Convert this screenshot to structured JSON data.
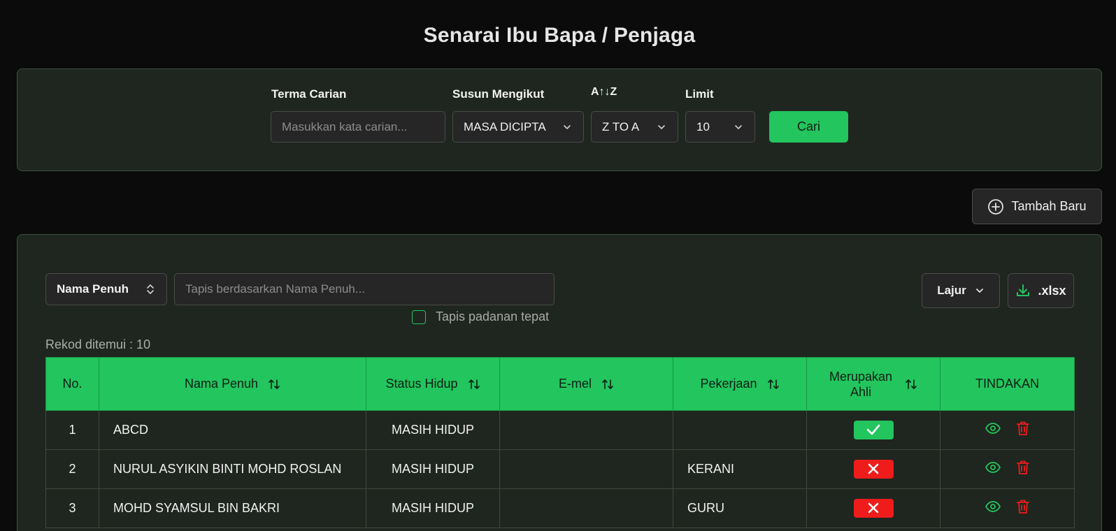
{
  "page": {
    "title": "Senarai Ibu Bapa / Penjaga"
  },
  "search": {
    "term_label": "Terma Carian",
    "term_placeholder": "Masukkan kata carian...",
    "sort_label": "Susun Mengikut",
    "sort_value": "MASA DICIPTA",
    "order_label": "A↑↓Z",
    "order_value": "Z TO A",
    "limit_label": "Limit",
    "limit_value": "10",
    "submit_label": "Cari"
  },
  "add_button": {
    "label": "Tambah Baru"
  },
  "filter": {
    "column_value": "Nama Penuh",
    "placeholder": "Tapis berdasarkan Nama Penuh...",
    "exact_match_label": "Tapis padanan tepat",
    "exact_match_checked": false,
    "columns_button": "Lajur",
    "export_button": ".xlsx"
  },
  "records": {
    "count_text": "Rekod ditemui : 10"
  },
  "table": {
    "headers": {
      "no": "No.",
      "name": "Nama Penuh",
      "status": "Status Hidup",
      "email": "E-mel",
      "job": "Pekerjaan",
      "member_line1": "Merupakan",
      "member_line2": "Ahli",
      "actions": "TINDAKAN"
    },
    "rows": [
      {
        "no": "1",
        "name": "ABCD",
        "status": "MASIH HIDUP",
        "email": "",
        "job": "",
        "member": true
      },
      {
        "no": "2",
        "name": "NURUL ASYIKIN BINTI MOHD ROSLAN",
        "status": "MASIH HIDUP",
        "email": "",
        "job": "KERANI",
        "member": false
      },
      {
        "no": "3",
        "name": "MOHD SYAMSUL BIN BAKRI",
        "status": "MASIH HIDUP",
        "email": "",
        "job": "GURU",
        "member": false
      }
    ]
  },
  "colors": {
    "accent": "#22c55e",
    "danger": "#ef1c1c",
    "panel": "#1f261f",
    "background": "#0b0b0b"
  }
}
